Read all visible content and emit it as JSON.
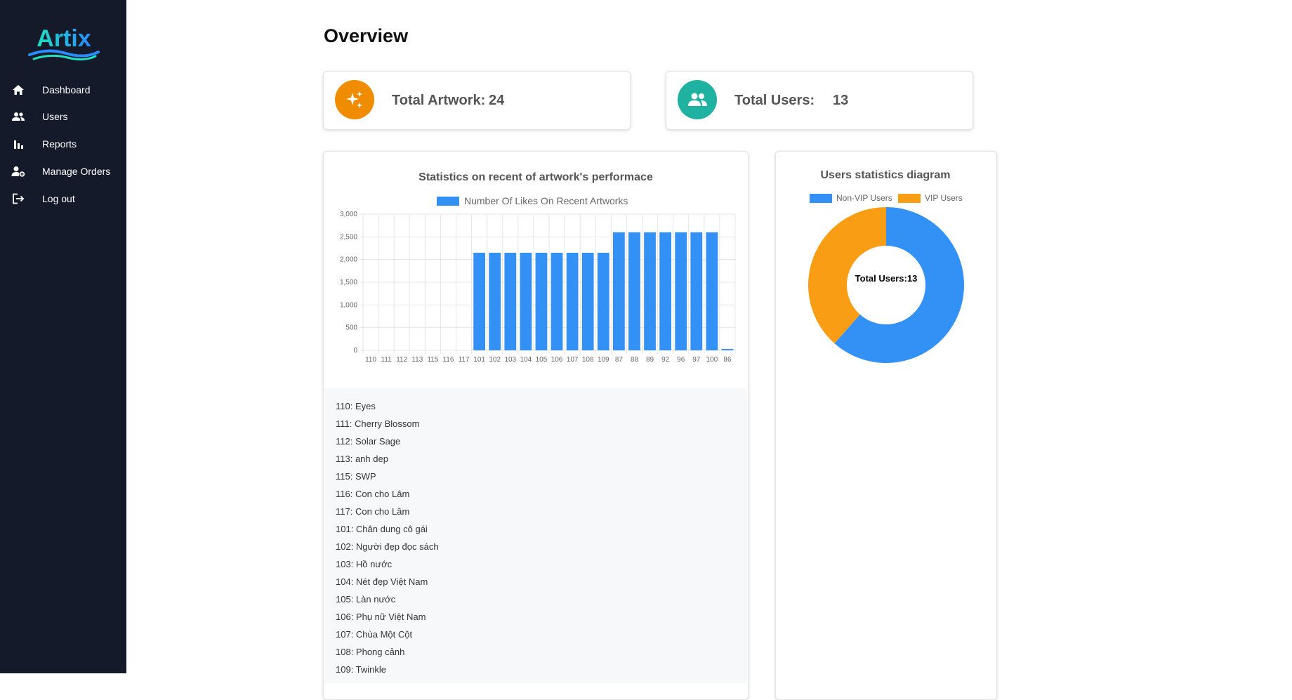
{
  "app": {
    "logo_text": "Artix"
  },
  "sidebar": {
    "items": [
      {
        "label": "Dashboard",
        "icon": "home-icon"
      },
      {
        "label": "Users",
        "icon": "users-icon"
      },
      {
        "label": "Reports",
        "icon": "bar-chart-icon"
      },
      {
        "label": "Manage Orders",
        "icon": "manage-orders-icon"
      },
      {
        "label": "Log out",
        "icon": "logout-icon"
      }
    ]
  },
  "page": {
    "title": "Overview"
  },
  "stats": {
    "artwork": {
      "label": "Total Artwork:",
      "value": "24",
      "icon": "sparkles-icon",
      "color": "#f08c00"
    },
    "users": {
      "label": "Total Users:",
      "value": "13",
      "icon": "users-icon",
      "color": "#20b2a0"
    }
  },
  "bar_chart_panel": {
    "list": [
      "110: Eyes",
      "111: Cherry Blossom",
      "112: Solar Sage",
      "113: anh dep",
      "115: SWP",
      "116: Con cho Lâm",
      "117: Con cho Lâm",
      "101: Chân dung cô gái",
      "102: Người đẹp đọc sách",
      "103: Hồ nước",
      "104: Nét đẹp Việt Nam",
      "105: Làn nước",
      "106: Phụ nữ Việt Nam",
      "107: Chùa Một Cột",
      "108: Phong cảnh",
      "109: Twinkle"
    ]
  },
  "donut_panel": {
    "center_text": "Total Users:13"
  },
  "chart_data": [
    {
      "type": "bar",
      "title": "Statistics on recent of artwork's performace",
      "categories": [
        "110",
        "111",
        "112",
        "113",
        "115",
        "116",
        "117",
        "101",
        "102",
        "103",
        "104",
        "105",
        "106",
        "107",
        "108",
        "109",
        "87",
        "88",
        "89",
        "92",
        "96",
        "97",
        "100",
        "86"
      ],
      "series": [
        {
          "name": "Number Of Likes On Recent Artworks",
          "color": "#3391f5",
          "values": [
            0,
            0,
            0,
            0,
            0,
            0,
            0,
            2150,
            2150,
            2150,
            2150,
            2150,
            2150,
            2150,
            2150,
            2150,
            2600,
            2600,
            2600,
            2600,
            2600,
            2600,
            2600,
            30
          ]
        }
      ],
      "ylim": [
        0,
        3000
      ],
      "yticks": [
        "3,000",
        "2,500",
        "2,000",
        "1,500",
        "1,000",
        "500",
        "0"
      ],
      "grid": true,
      "legend": "top"
    },
    {
      "type": "pie",
      "title": "Users statistics diagram",
      "labels": [
        "Non-VIP Users",
        "VIP Users"
      ],
      "values": [
        8,
        5
      ],
      "colors": [
        "#3391f5",
        "#f99e14"
      ],
      "legend": "top"
    }
  ]
}
